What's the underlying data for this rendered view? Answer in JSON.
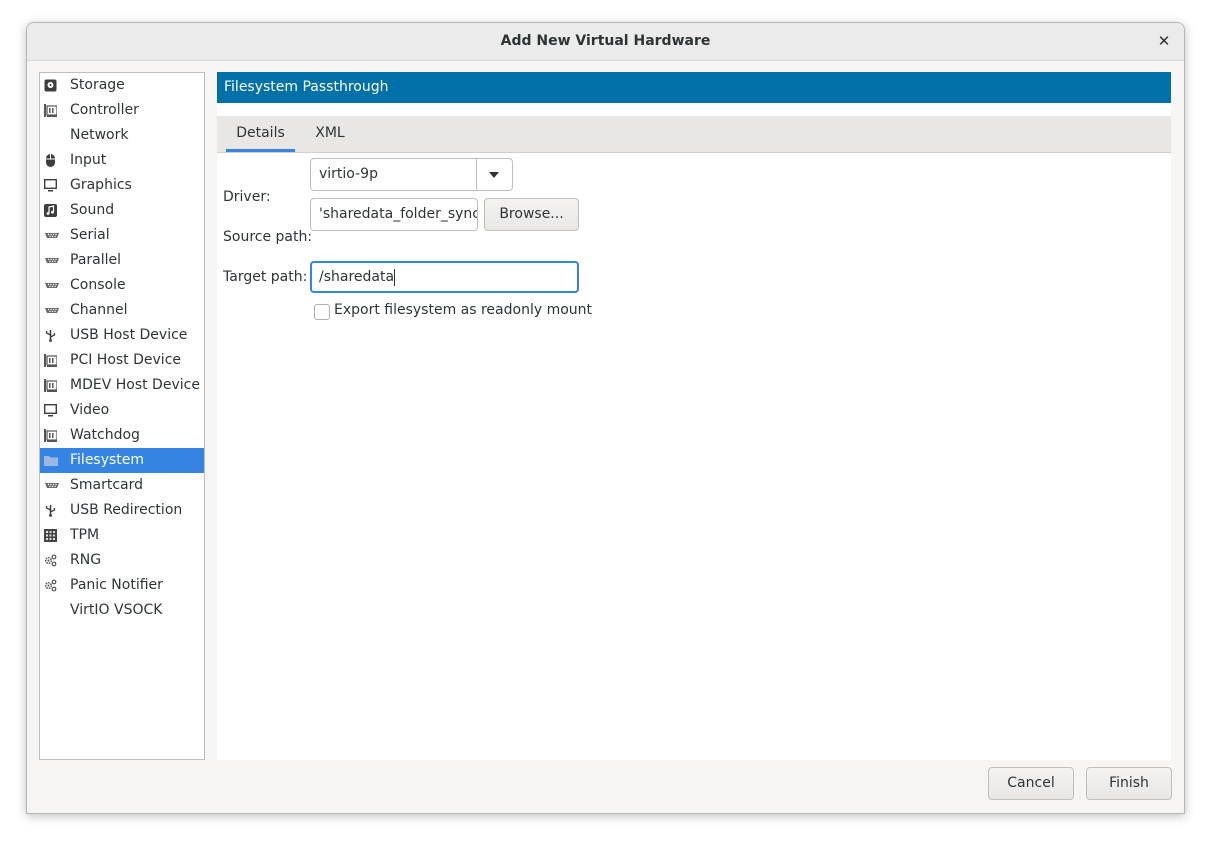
{
  "window": {
    "title": "Add New Virtual Hardware"
  },
  "sidebar": {
    "items": [
      {
        "label": "Storage",
        "icon": "disk-icon"
      },
      {
        "label": "Controller",
        "icon": "chip-icon"
      },
      {
        "label": "Network",
        "icon": ""
      },
      {
        "label": "Input",
        "icon": "mouse-icon"
      },
      {
        "label": "Graphics",
        "icon": "monitor-icon"
      },
      {
        "label": "Sound",
        "icon": "music-note-icon"
      },
      {
        "label": "Serial",
        "icon": "serial-port-icon"
      },
      {
        "label": "Parallel",
        "icon": "serial-port-icon"
      },
      {
        "label": "Console",
        "icon": "serial-port-icon"
      },
      {
        "label": "Channel",
        "icon": "serial-port-icon"
      },
      {
        "label": "USB Host Device",
        "icon": "usb-icon"
      },
      {
        "label": "PCI Host Device",
        "icon": "chip-icon"
      },
      {
        "label": "MDEV Host Device",
        "icon": "chip-icon"
      },
      {
        "label": "Video",
        "icon": "monitor-icon"
      },
      {
        "label": "Watchdog",
        "icon": "chip-icon"
      },
      {
        "label": "Filesystem",
        "icon": "folder-icon",
        "selected": true
      },
      {
        "label": "Smartcard",
        "icon": "serial-port-icon"
      },
      {
        "label": "USB Redirection",
        "icon": "usb-icon"
      },
      {
        "label": "TPM",
        "icon": "tpm-chip-icon"
      },
      {
        "label": "RNG",
        "icon": "gear-icon"
      },
      {
        "label": "Panic Notifier",
        "icon": "gear-icon"
      },
      {
        "label": "VirtIO VSOCK",
        "icon": ""
      }
    ]
  },
  "header": {
    "title": "Filesystem Passthrough"
  },
  "tabs": [
    {
      "label": "Details",
      "active": true
    },
    {
      "label": "XML",
      "active": false
    }
  ],
  "form": {
    "driver_label": "Driver:",
    "driver_value": "virtio-9p",
    "source_label": "Source path:",
    "source_value": "'sharedata_folder_sync",
    "browse_label": "Browse...",
    "target_label": "Target path:",
    "target_value": "/sharedata",
    "readonly_label": "Export filesystem as readonly mount",
    "readonly_checked": false
  },
  "footer": {
    "cancel_label": "Cancel",
    "finish_label": "Finish"
  },
  "colors": {
    "accent": "#3584e4",
    "header_bg": "#0070a8"
  }
}
